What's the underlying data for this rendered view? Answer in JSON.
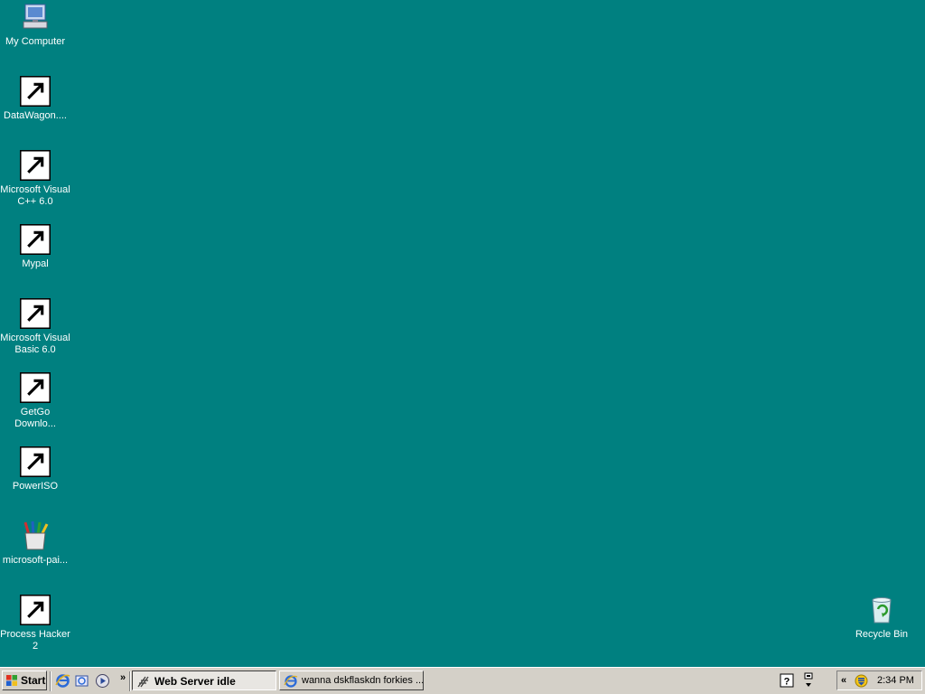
{
  "desktop": {
    "background": "#008080",
    "icons": [
      {
        "label": "My Computer",
        "icon": "my-computer-icon"
      },
      {
        "label": "DataWagon....",
        "icon": "datawagon-icon"
      },
      {
        "label": "Microsoft Visual C++ 6.0",
        "icon": "visual-cpp-icon"
      },
      {
        "label": "Mypal",
        "icon": "mypal-icon"
      },
      {
        "label": "Microsoft Visual Basic 6.0",
        "icon": "visual-basic-icon"
      },
      {
        "label": "GetGo Downlo...",
        "icon": "getgo-download-icon"
      },
      {
        "label": "PowerISO",
        "icon": "poweriso-icon"
      },
      {
        "label": "microsoft-pai...",
        "icon": "paint-icon"
      },
      {
        "label": "Process Hacker 2",
        "icon": "process-hacker-icon"
      },
      {
        "label": "Recycle Bin",
        "icon": "recycle-bin-icon"
      }
    ]
  },
  "taskbar": {
    "start_label": "Start",
    "quick_launch": [
      "internet-explorer-icon",
      "outlook-express-icon",
      "media-player-icon"
    ],
    "chevron": "»",
    "tasks": [
      {
        "label": "Web Server idle",
        "icon": "web-server-icon",
        "active": true
      },
      {
        "label": "wanna dskflaskdn forkies ...",
        "icon": "internet-explorer-icon",
        "active": false
      }
    ],
    "tray": {
      "expand": "«",
      "clock": "2:34 PM"
    }
  }
}
